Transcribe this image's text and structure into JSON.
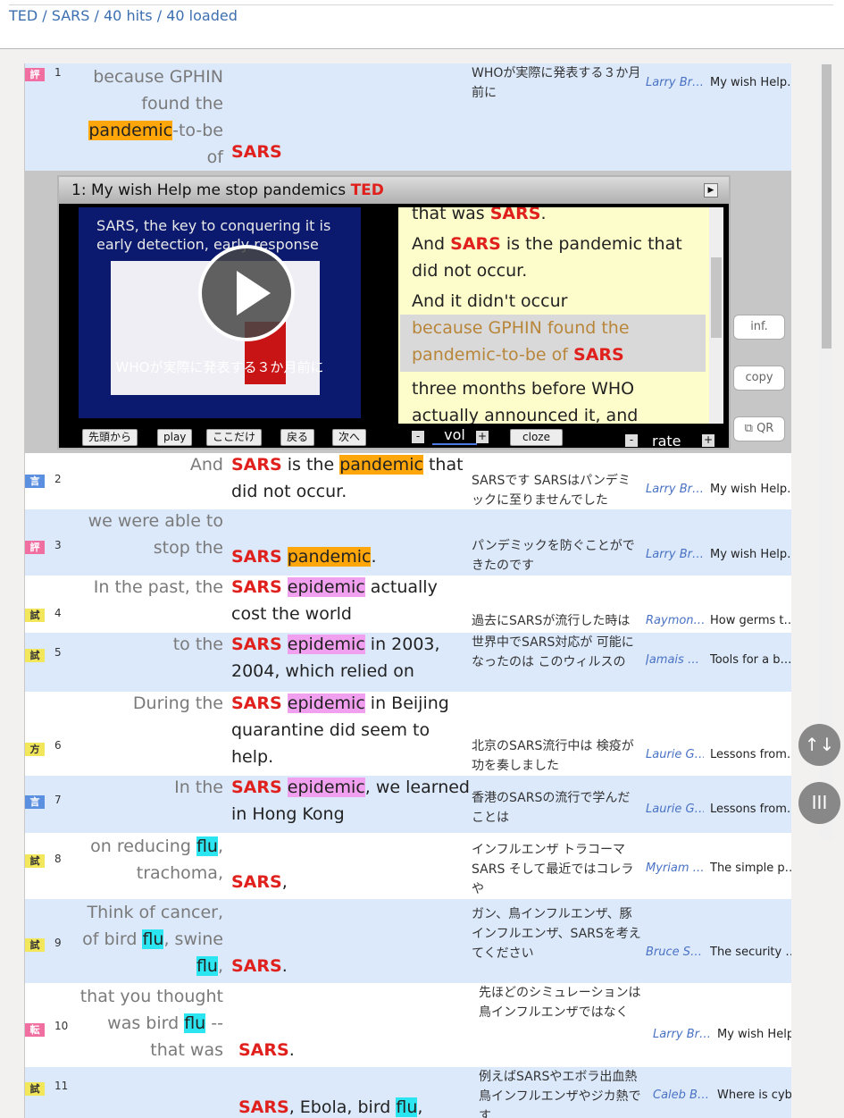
{
  "breadcrumb": [
    "TED",
    "SARS",
    "40 hits",
    "40 loaded"
  ],
  "breadcrumb_sep": " / ",
  "player": {
    "title_prefix": "1: My wish Help me stop pandemics ",
    "title_source": "TED",
    "video_text_line1": "SARS, the key to conquering it is",
    "video_text_line2": "early detection, early response",
    "video_subtitle": "WHOが実際に発表する３か月前に",
    "transcript": [
      {
        "pre": "that was ",
        "kw": "SARS",
        "post": "."
      },
      {
        "pre": "And ",
        "kw": "SARS",
        "post": " is the pandemic that"
      },
      {
        "pre": " did not occur.",
        "kw": "",
        "post": ""
      },
      {
        "pre": "And it didn't occur",
        "kw": "",
        "post": ""
      },
      {
        "pre": "because GPHIN found the",
        "kw": "",
        "post": ""
      },
      {
        "pre": " pandemic-to-be of ",
        "kw": "SARS",
        "post": ""
      },
      {
        "pre": "three months before WHO",
        "kw": "",
        "post": ""
      },
      {
        "pre": " actually announced it, and",
        "kw": "",
        "post": ""
      }
    ],
    "controls": {
      "from_start": "先頭から",
      "play": "play",
      "only_here": "ここだけ",
      "back": "戻る",
      "next": "次へ",
      "minus": "-",
      "plus": "+",
      "vol": "vol",
      "cloze": "cloze",
      "rate": "rate"
    }
  },
  "side": {
    "inf": "inf.",
    "copy": "copy",
    "qr": "QR"
  },
  "fab": {
    "sort": "↑↓",
    "columns": "III"
  },
  "rows": [
    {
      "num": "1",
      "badge": "評",
      "left": [
        "because GPHIN",
        "found the",
        "pandemic-to-be",
        "of"
      ],
      "ja": "WHOが実際に発表する３か月前に",
      "speaker": "Larry Br…",
      "talk": "My wish Help…"
    },
    {
      "num": "2",
      "badge": "言",
      "ja": "SARSです SARSはパンデミックに至りませんでした",
      "speaker": "Larry Br…",
      "talk": "My wish Help…",
      "left": "And",
      "right_pre": "",
      "right_post1": " is the ",
      "right_hl": "pandemic",
      "right_post2": " that did not occur."
    },
    {
      "num": "3",
      "badge": "評",
      "left": [
        "we were able to",
        "stop the"
      ],
      "ja": "パンデミックを防ぐことができたのです",
      "speaker": "Larry Br…",
      "talk": "My wish Help…"
    },
    {
      "num": "4",
      "badge": "試",
      "left": "In the past, the",
      "right_hl": "epidemic",
      "right_post": " actually cost the world",
      "ja": "過去にSARSが流行した時は",
      "speaker": "Raymon…",
      "talk": "How germs t…"
    },
    {
      "num": "5",
      "badge": "試",
      "left": "to the",
      "right_hl": "epidemic",
      "right_post": " in 2003, 2004, which relied on",
      "ja": "世界中でSARS対応が 可能になったのは このウィルスの",
      "speaker": "Jamais …",
      "talk": "Tools for a b…"
    },
    {
      "num": "6",
      "badge": "方",
      "left": "During the",
      "right_hl": "epidemic",
      "right_post": " in Beijing quarantine did seem to help.",
      "ja": "北京のSARS流行中は 検疫が功を奏しました",
      "speaker": "Laurie G…",
      "talk": "Lessons from…"
    },
    {
      "num": "7",
      "badge": "言",
      "left": "In the",
      "right_hl": "epidemic",
      "right_post": ", we learned in Hong Kong",
      "ja": "香港のSARSの流行で学んだことは",
      "speaker": "Laurie G…",
      "talk": "Lessons from…"
    },
    {
      "num": "8",
      "badge": "試",
      "left1_pre": "on reducing ",
      "left1_hl": "flu",
      "left1_post": ",",
      "left2": "trachoma,",
      "right_post": ",",
      "ja": "インフルエンザ トラコーマ SARS そして最近ではコレラや",
      "speaker": "Myriam …",
      "talk": "The simple p…"
    },
    {
      "num": "9",
      "badge": "試",
      "left1": "Think of cancer,",
      "left2_pre": "of bird ",
      "left2_hl": "flu",
      "left2_post": ", swine",
      "left3_hl": "flu",
      "left3_post": ",",
      "right_post": ".",
      "ja": "ガン、鳥インフルエンザ、豚インフルエンザ、SARSを考えてください",
      "speaker": "Bruce S…",
      "talk": "The security …"
    },
    {
      "num": "10",
      "badge": "転",
      "left1": "that you thought",
      "left2_pre": "was bird ",
      "left2_hl": "flu",
      "left2_post": " --",
      "left3": "that was",
      "right_post": ".",
      "ja": "先ほどのシミュレーションは鳥インフルエンザではなく",
      "speaker": "Larry Br…",
      "talk": "My wish Help…"
    },
    {
      "num": "11",
      "badge": "試",
      "right_post": ", Ebola, bird ",
      "right_hl": "flu",
      "right_tail": ",",
      "ja": "例えばSARSやエボラ出血熱 鳥インフルエンザやジカ熱です",
      "speaker": "Caleb B…",
      "talk": "Where is cyb…"
    }
  ],
  "keyword": "SARS",
  "colors": {
    "keyword": "#e0201c",
    "hl_pandemic": "#ffa60a",
    "hl_epidemic": "#f0a0ee",
    "hl_flu": "#2be6f0",
    "row_alt": "#dce9fb",
    "link": "#3d6fb0"
  }
}
